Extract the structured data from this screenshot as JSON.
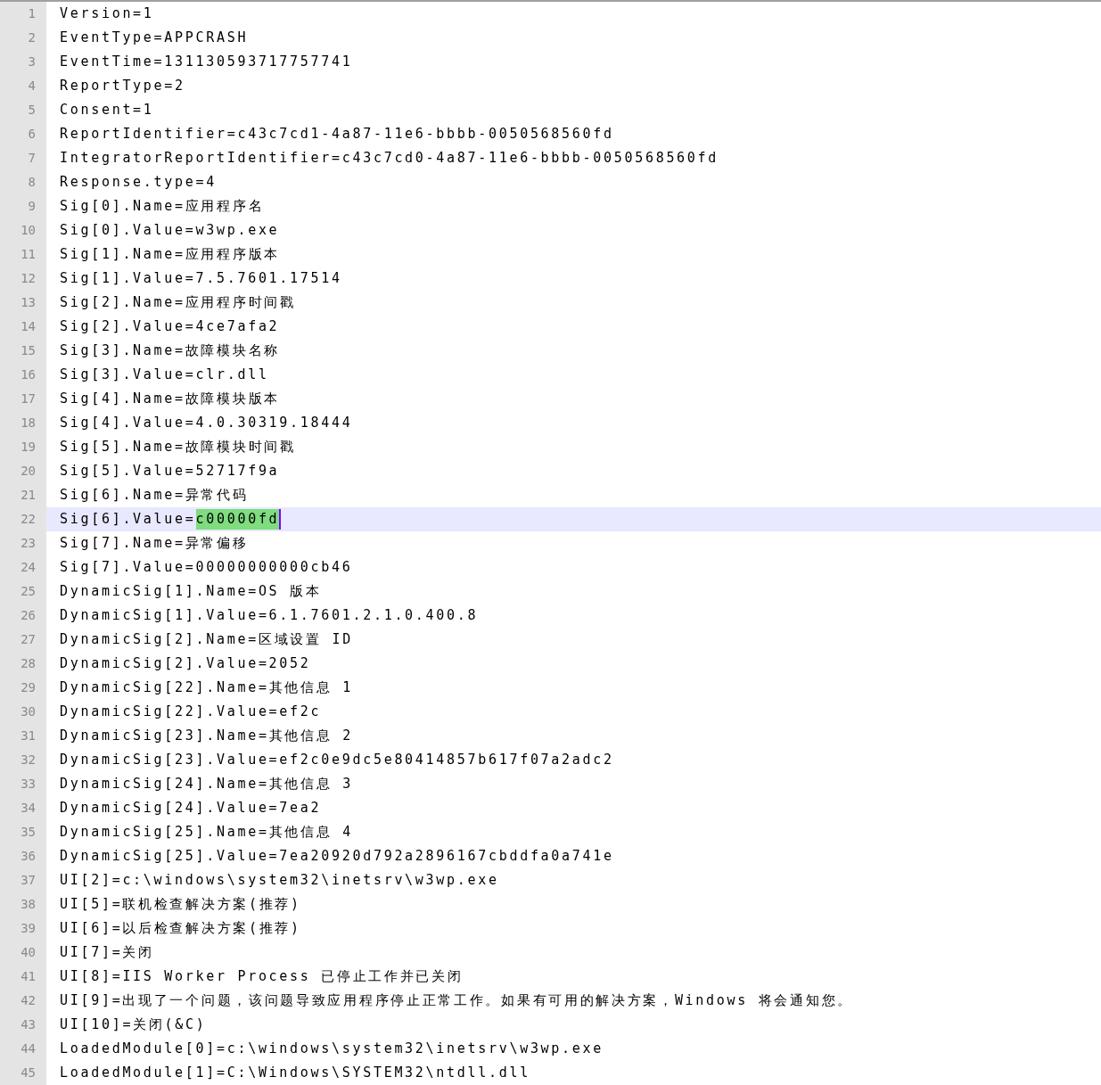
{
  "lines": [
    {
      "number": "1",
      "text": "Version=1",
      "current": false
    },
    {
      "number": "2",
      "text": "EventType=APPCRASH",
      "current": false
    },
    {
      "number": "3",
      "text": "EventTime=131130593717757741",
      "current": false
    },
    {
      "number": "4",
      "text": "ReportType=2",
      "current": false
    },
    {
      "number": "5",
      "text": "Consent=1",
      "current": false
    },
    {
      "number": "6",
      "text": "ReportIdentifier=c43c7cd1-4a87-11e6-bbbb-0050568560fd",
      "current": false
    },
    {
      "number": "7",
      "text": "IntegratorReportIdentifier=c43c7cd0-4a87-11e6-bbbb-0050568560fd",
      "current": false
    },
    {
      "number": "8",
      "text": "Response.type=4",
      "current": false
    },
    {
      "number": "9",
      "text": "Sig[0].Name=应用程序名",
      "current": false
    },
    {
      "number": "10",
      "text": "Sig[0].Value=w3wp.exe",
      "current": false
    },
    {
      "number": "11",
      "text": "Sig[1].Name=应用程序版本",
      "current": false
    },
    {
      "number": "12",
      "text": "Sig[1].Value=7.5.7601.17514",
      "current": false
    },
    {
      "number": "13",
      "text": "Sig[2].Name=应用程序时间戳",
      "current": false
    },
    {
      "number": "14",
      "text": "Sig[2].Value=4ce7afa2",
      "current": false
    },
    {
      "number": "15",
      "text": "Sig[3].Name=故障模块名称",
      "current": false
    },
    {
      "number": "16",
      "text": "Sig[3].Value=clr.dll",
      "current": false
    },
    {
      "number": "17",
      "text": "Sig[4].Name=故障模块版本",
      "current": false
    },
    {
      "number": "18",
      "text": "Sig[4].Value=4.0.30319.18444",
      "current": false
    },
    {
      "number": "19",
      "text": "Sig[5].Name=故障模块时间戳",
      "current": false
    },
    {
      "number": "20",
      "text": "Sig[5].Value=52717f9a",
      "current": false
    },
    {
      "number": "21",
      "text": "Sig[6].Name=异常代码",
      "current": false
    },
    {
      "number": "22",
      "text": "Sig[6].Value=",
      "selected_text": "c00000fd",
      "current": true
    },
    {
      "number": "23",
      "text": "Sig[7].Name=异常偏移",
      "current": false
    },
    {
      "number": "24",
      "text": "Sig[7].Value=00000000000cb46",
      "current": false
    },
    {
      "number": "25",
      "text": "DynamicSig[1].Name=OS 版本",
      "current": false
    },
    {
      "number": "26",
      "text": "DynamicSig[1].Value=6.1.7601.2.1.0.400.8",
      "current": false
    },
    {
      "number": "27",
      "text": "DynamicSig[2].Name=区域设置 ID",
      "current": false
    },
    {
      "number": "28",
      "text": "DynamicSig[2].Value=2052",
      "current": false
    },
    {
      "number": "29",
      "text": "DynamicSig[22].Name=其他信息 1",
      "current": false
    },
    {
      "number": "30",
      "text": "DynamicSig[22].Value=ef2c",
      "current": false
    },
    {
      "number": "31",
      "text": "DynamicSig[23].Name=其他信息 2",
      "current": false
    },
    {
      "number": "32",
      "text": "DynamicSig[23].Value=ef2c0e9dc5e80414857b617f07a2adc2",
      "current": false
    },
    {
      "number": "33",
      "text": "DynamicSig[24].Name=其他信息 3",
      "current": false
    },
    {
      "number": "34",
      "text": "DynamicSig[24].Value=7ea2",
      "current": false
    },
    {
      "number": "35",
      "text": "DynamicSig[25].Name=其他信息 4",
      "current": false
    },
    {
      "number": "36",
      "text": "DynamicSig[25].Value=7ea20920d792a2896167cbddfa0a741e",
      "current": false
    },
    {
      "number": "37",
      "text": "UI[2]=c:\\windows\\system32\\inetsrv\\w3wp.exe",
      "current": false
    },
    {
      "number": "38",
      "text": "UI[5]=联机检查解决方案(推荐)",
      "current": false
    },
    {
      "number": "39",
      "text": "UI[6]=以后检查解决方案(推荐)",
      "current": false
    },
    {
      "number": "40",
      "text": "UI[7]=关闭",
      "current": false
    },
    {
      "number": "41",
      "text": "UI[8]=IIS Worker Process 已停止工作并已关闭",
      "current": false
    },
    {
      "number": "42",
      "text": "UI[9]=出现了一个问题，该问题导致应用程序停止正常工作。如果有可用的解决方案，Windows 将会通知您。",
      "current": false
    },
    {
      "number": "43",
      "text": "UI[10]=关闭(&C)",
      "current": false
    },
    {
      "number": "44",
      "text": "LoadedModule[0]=c:\\windows\\system32\\inetsrv\\w3wp.exe",
      "current": false
    },
    {
      "number": "45",
      "text": "LoadedModule[1]=C:\\Windows\\SYSTEM32\\ntdll.dll",
      "current": false
    }
  ]
}
